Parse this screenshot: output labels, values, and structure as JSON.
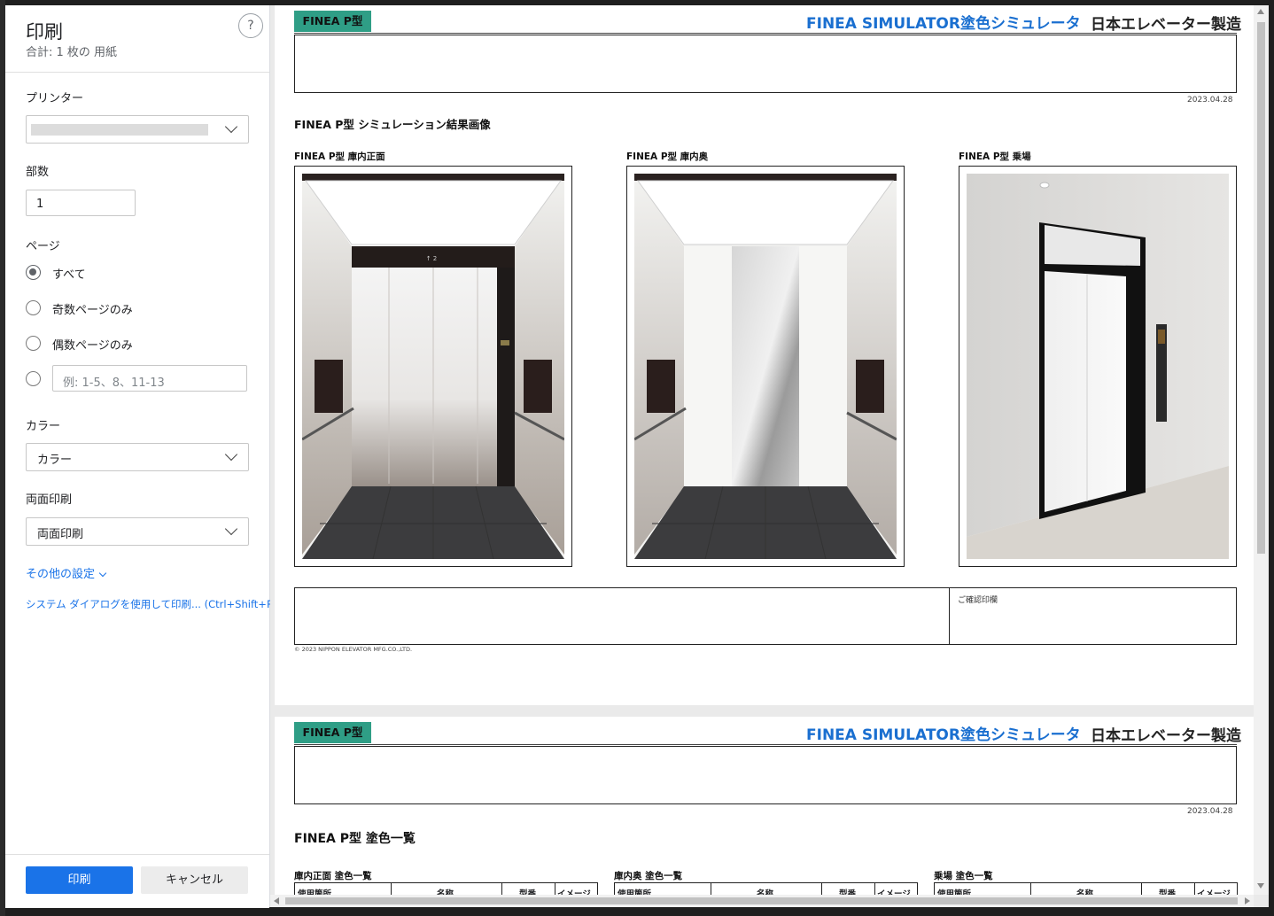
{
  "sidebar": {
    "title": "印刷",
    "subtitle": "合計: 1 枚の 用紙",
    "help_icon": "?",
    "printer_label": "プリンター",
    "copies_label": "部数",
    "copies_value": "1",
    "pages_label": "ページ",
    "pages_options": [
      "すべて",
      "奇数ページのみ",
      "偶数ページのみ"
    ],
    "pages_custom_placeholder": "例: 1-5、8、11-13",
    "color_label": "カラー",
    "color_value": "カラー",
    "duplex_label": "両面印刷",
    "duplex_value": "両面印刷",
    "more_settings": "その他の設定",
    "system_dialog": "システム ダイアログを使用して印刷... (Ctrl+Shift+P)",
    "print_button": "印刷",
    "cancel_button": "キャンセル"
  },
  "page1": {
    "badge": "FINEA P型",
    "header_blue": "FINEA SIMULATOR塗色シミュレータ",
    "header_brand": "日本エレベーター製造",
    "date": "2023.04.28",
    "section_title": "FINEA P型 シミュレーション結果画像",
    "images": [
      {
        "label": "FINEA P型 庫内正面"
      },
      {
        "label": "FINEA P型 庫内奥"
      },
      {
        "label": "FINEA P型 乗場"
      }
    ],
    "floor_indicator": "↑ 2",
    "confirm_label": "ご確認印欄",
    "copyright": "© 2023 NIPPON ELEVATOR MFG.CO.,LTD."
  },
  "page2": {
    "badge": "FINEA P型",
    "header_blue": "FINEA SIMULATOR塗色シミュレータ",
    "header_brand": "日本エレベーター製造",
    "date": "2023.04.28",
    "section_title": "FINEA P型 塗色一覧",
    "tables": [
      {
        "label": "庫内正面 塗色一覧",
        "headers": [
          "使用箇所",
          "名称",
          "型番",
          "イメージ"
        ]
      },
      {
        "label": "庫内奥 塗色一覧",
        "headers": [
          "使用箇所",
          "名称",
          "型番",
          "イメージ"
        ]
      },
      {
        "label": "乗場 塗色一覧",
        "headers": [
          "使用箇所",
          "名称",
          "型番",
          "イメージ"
        ]
      }
    ]
  },
  "colors": {
    "accent": "#1a73e8",
    "badge": "#2f9e86",
    "header_blue": "#1a6fd0"
  }
}
